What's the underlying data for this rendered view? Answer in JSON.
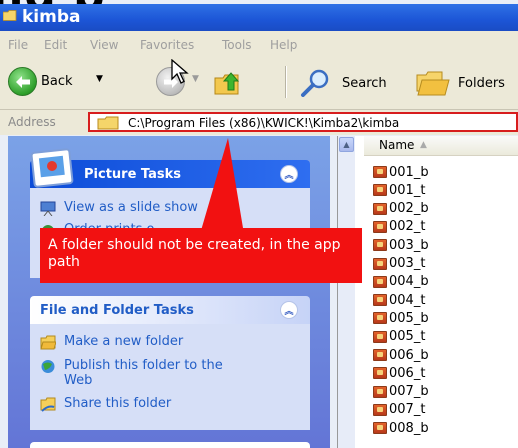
{
  "slide": {
    "heading_fragment": "ng p"
  },
  "window": {
    "title": "kimba"
  },
  "menu": [
    "File",
    "Edit",
    "View",
    "Favorites",
    "Tools",
    "Help"
  ],
  "toolbar": {
    "back": "Back",
    "search": "Search",
    "folders": "Folders"
  },
  "address": {
    "label": "Address",
    "path": "C:\\Program Files (x86)\\KWICK!\\Kimba2\\kimba"
  },
  "picture_tasks": {
    "title": "Picture Tasks",
    "items": [
      "View as a slide show",
      "Order prints o"
    ]
  },
  "file_folder_tasks": {
    "title": "File and Folder Tasks",
    "items": [
      "Make a new folder",
      "Publish this folder to the Web",
      "Share this folder"
    ]
  },
  "annotation": {
    "text": "A folder should not be created, in the app path",
    "color": "#f21111"
  },
  "files": {
    "column": "Name",
    "items": [
      "001_b",
      "001_t",
      "002_b",
      "002_t",
      "003_b",
      "003_t",
      "004_b",
      "004_t",
      "005_b",
      "005_t",
      "006_b",
      "006_t",
      "007_b",
      "007_t",
      "008_b"
    ]
  }
}
